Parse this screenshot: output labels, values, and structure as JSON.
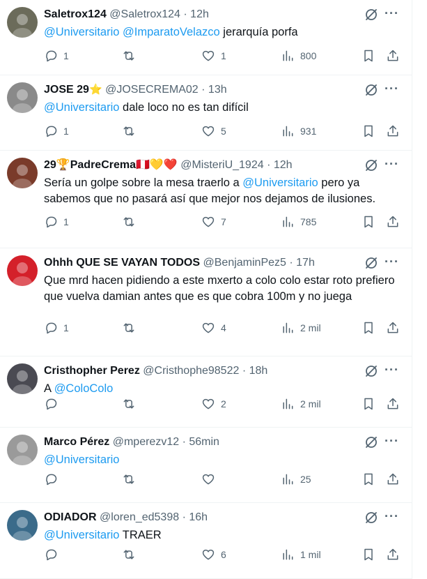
{
  "tweets": [
    {
      "name": "Saletrox124",
      "handle": "@Saletrox124",
      "sep": "·",
      "time": "12h",
      "badge": "",
      "text_parts": [
        {
          "t": "@Universitario",
          "m": true
        },
        {
          "t": " ",
          "m": false
        },
        {
          "t": "@ImparatoVelazco",
          "m": true
        },
        {
          "t": " jerarquía porfa",
          "m": false
        }
      ],
      "replies": "1",
      "retweets": "",
      "likes": "1",
      "views": "800",
      "avatar_color": "#6b6b5a"
    },
    {
      "name": "JOSE 29",
      "handle": "@JOSECREMA02",
      "sep": "·",
      "time": "13h",
      "badge": "⭐",
      "text_parts": [
        {
          "t": "@Universitario",
          "m": true
        },
        {
          "t": " dale loco no es tan difícil",
          "m": false
        }
      ],
      "replies": "1",
      "retweets": "",
      "likes": "5",
      "views": "931",
      "avatar_color": "#8a8a8a"
    },
    {
      "name": "29🏆PadreCrema🇵🇪💛❤️",
      "handle": "@MisteriU_1924",
      "sep": "·",
      "time": "12h",
      "badge": "",
      "text_parts": [
        {
          "t": "Sería un golpe sobre la mesa traerlo a ",
          "m": false
        },
        {
          "t": "@Universitario",
          "m": true
        },
        {
          "t": " pero ya sabemos que no pasará así que mejor nos dejamos de ilusiones.",
          "m": false
        }
      ],
      "replies": "1",
      "retweets": "",
      "likes": "7",
      "views": "785",
      "avatar_color": "#7a3b2a"
    },
    {
      "name": "Ohhh QUE SE VAYAN TODOS",
      "handle": "@BenjaminPez5",
      "sep": "·",
      "time": "17h",
      "badge": "",
      "text_parts": [
        {
          "t": "Que mrd hacen pidiendo a este mxerto a colo colo estar roto prefiero que vuelva damian antes que es que cobra 100m y no juega",
          "m": false
        }
      ],
      "replies": "1",
      "retweets": "",
      "likes": "4",
      "views": "2 mil",
      "avatar_color": "#d4202a"
    },
    {
      "name": "Cristhopher Perez",
      "handle": "@Cristhophe98522",
      "sep": "·",
      "time": "18h",
      "badge": "",
      "text_parts": [
        {
          "t": "A ",
          "m": false
        },
        {
          "t": "@ColoColo",
          "m": true
        }
      ],
      "replies": "",
      "retweets": "",
      "likes": "2",
      "views": "2 mil",
      "avatar_color": "#4a4a52"
    },
    {
      "name": "Marco Pérez",
      "handle": "@mperezv12",
      "sep": "·",
      "time": "56min",
      "badge": "",
      "text_parts": [
        {
          "t": "@Universitario",
          "m": true
        }
      ],
      "replies": "",
      "retweets": "",
      "likes": "",
      "views": "25",
      "avatar_color": "#9a9a9a"
    },
    {
      "name": "ODIADOR",
      "handle": "@loren_ed5398",
      "sep": "·",
      "time": "16h",
      "badge": "",
      "text_parts": [
        {
          "t": "@Universitario",
          "m": true
        },
        {
          "t": " TRAER",
          "m": false
        }
      ],
      "replies": "",
      "retweets": "",
      "likes": "6",
      "views": "1 mil",
      "avatar_color": "#3b6b8a"
    }
  ],
  "icons": {
    "reply": "reply-icon",
    "retweet": "retweet-icon",
    "like": "heart-icon",
    "views": "views-icon",
    "bookmark": "bookmark-icon",
    "share": "share-icon",
    "grok": "grok-icon",
    "more": "more-icon"
  },
  "colors": {
    "link": "#1d9bf0",
    "muted": "#536471",
    "text": "#0f1419"
  },
  "more_glyph": "···"
}
